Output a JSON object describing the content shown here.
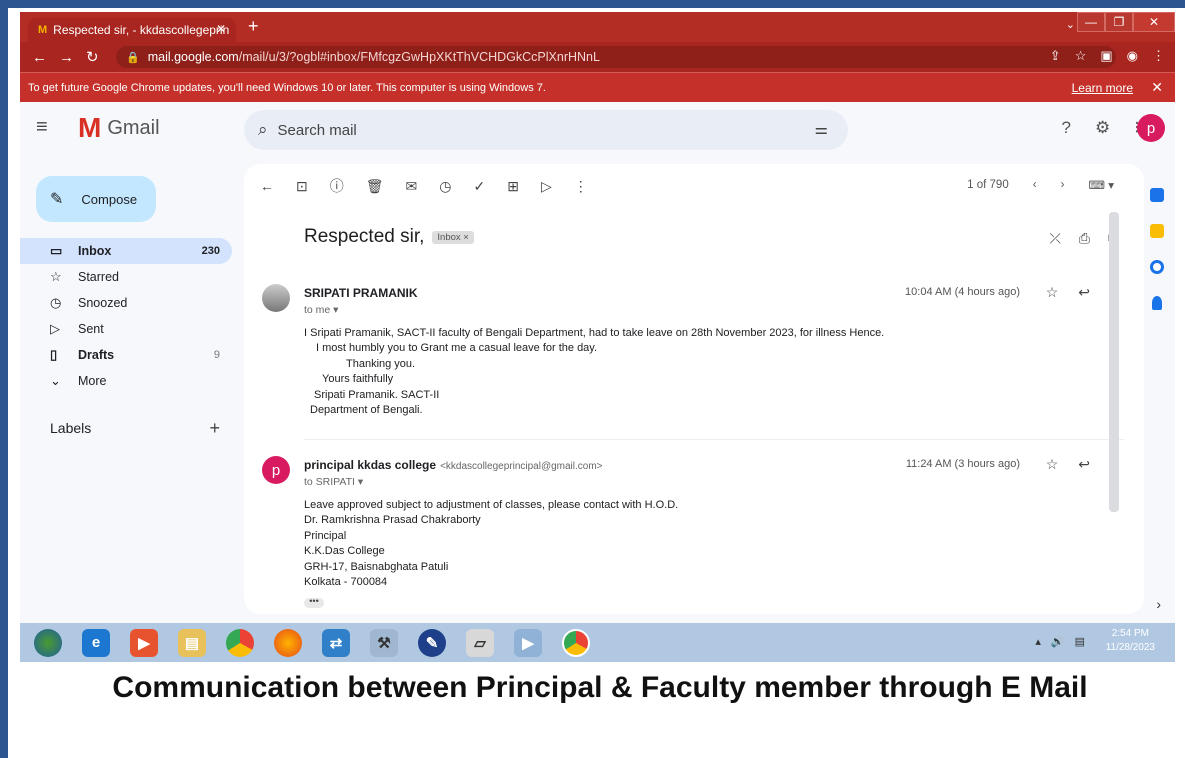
{
  "browser": {
    "tab_title": "Respected sir, - kkdascollegeprin",
    "url_host": "mail.google.com",
    "url_path": "/mail/u/3/?ogbl#inbox/FMfcgzGwHpXKtThVCHDGkCcPlXnrHNnL",
    "warning_text": "To get future Google Chrome updates, you'll need Windows 10 or later. This computer is using Windows 7.",
    "learn_more": "Learn more"
  },
  "gmail": {
    "brand": "Gmail",
    "search_placeholder": "Search mail",
    "avatar_letter": "p",
    "compose_label": "Compose",
    "nav": [
      {
        "label": "Inbox",
        "count": "230"
      },
      {
        "label": "Starred",
        "count": ""
      },
      {
        "label": "Snoozed",
        "count": ""
      },
      {
        "label": "Sent",
        "count": ""
      },
      {
        "label": "Drafts",
        "count": "9"
      },
      {
        "label": "More",
        "count": ""
      }
    ],
    "labels_heading": "Labels"
  },
  "thread": {
    "pager": "1 of 790",
    "subject": "Respected sir,",
    "badge": "Inbox ×",
    "messages": [
      {
        "sender": "SRIPATI PRAMANIK",
        "to": "to me",
        "time": "10:04 AM (4 hours ago)",
        "body": [
          "I Sripati Pramanik, SACT-II faculty of Bengali Department, had to take leave on 28th November 2023, for illness Hence.",
          "I most humbly you to Grant me a casual leave for the day.",
          "Thanking you.",
          "Yours faithfully",
          "Sripati Pramanik. SACT-II",
          "Department of Bengali."
        ]
      },
      {
        "sender": "principal kkdas college",
        "email": "<kkdascollegeprincipal@gmail.com>",
        "to": "to SRIPATI",
        "time": "11:24 AM (3 hours ago)",
        "avatar_letter": "p",
        "body": [
          "Leave approved  subject to adjustment of classes, please contact with H.O.D.",
          "Dr. Ramkrishna Prasad Chakraborty",
          "Principal",
          "K.K.Das College",
          "GRH-17, Baisnabghata Patuli",
          "Kolkata - 700084"
        ]
      }
    ]
  },
  "taskbar": {
    "time": "2:54 PM",
    "date": "11/28/2023"
  },
  "caption": "Communication between Principal & Faculty member through E Mail"
}
